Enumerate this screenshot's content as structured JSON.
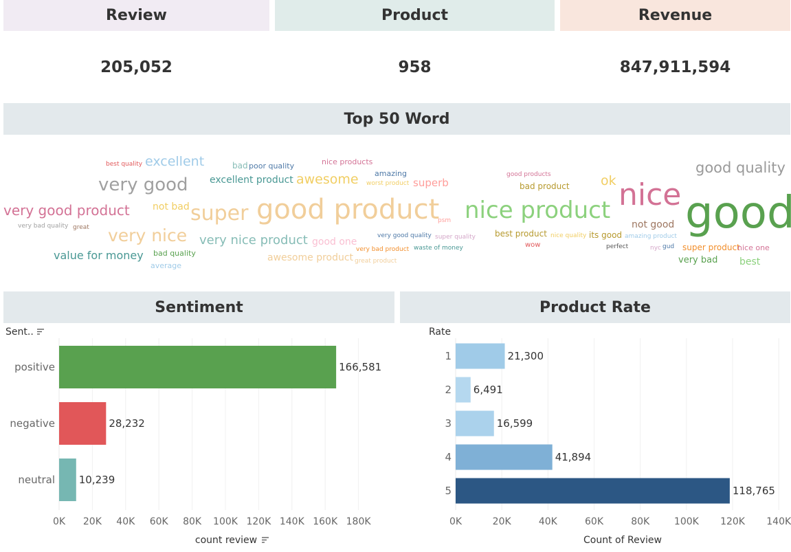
{
  "kpis": [
    {
      "label": "Review",
      "value": "205,052",
      "color": "#f1ebf3"
    },
    {
      "label": "Product",
      "value": "958",
      "color": "#e0ecea"
    },
    {
      "label": "Revenue",
      "value": "847,911,594",
      "color": "#f9e6dd"
    }
  ],
  "wordcloud": {
    "title": "Top 50 Word",
    "words": [
      {
        "text": "good",
        "color": "#59a14f"
      },
      {
        "text": "nice",
        "color": "#d37295"
      },
      {
        "text": "good product",
        "color": "#f1ce9a"
      },
      {
        "text": "nice product",
        "color": "#8cd17d"
      },
      {
        "text": "very good",
        "color": "#a0a0a0"
      },
      {
        "text": "super",
        "color": "#f1ce9a"
      },
      {
        "text": "very nice",
        "color": "#f1ce9a"
      },
      {
        "text": "very good product",
        "color": "#d37295"
      },
      {
        "text": "good quality",
        "color": "#9a9a9a"
      },
      {
        "text": "excellent",
        "color": "#a0cbe8"
      },
      {
        "text": "awesome",
        "color": "#f1ce63"
      },
      {
        "text": "very nice product",
        "color": "#86bcb6"
      },
      {
        "text": "value for money",
        "color": "#499894"
      },
      {
        "text": "excellent product",
        "color": "#499894"
      },
      {
        "text": "superb",
        "color": "#ff9d9a"
      },
      {
        "text": "ok",
        "color": "#f1ce63"
      },
      {
        "text": "awesome product",
        "color": "#f1ce9a"
      },
      {
        "text": "not good",
        "color": "#9d7660"
      },
      {
        "text": "good one",
        "color": "#fabfd2"
      },
      {
        "text": "not bad",
        "color": "#f1ce63"
      },
      {
        "text": "very bad",
        "color": "#59a14f"
      },
      {
        "text": "best",
        "color": "#8cd17d"
      },
      {
        "text": "best product",
        "color": "#b6992d"
      },
      {
        "text": "bad product",
        "color": "#b6992d"
      },
      {
        "text": "poor quality",
        "color": "#4e79a7"
      },
      {
        "text": "bad",
        "color": "#86bcb6"
      },
      {
        "text": "nice products",
        "color": "#d37295"
      },
      {
        "text": "amazing",
        "color": "#4e79a7"
      },
      {
        "text": "bad quality",
        "color": "#59a14f"
      },
      {
        "text": "average",
        "color": "#a0cbe8"
      },
      {
        "text": "super product",
        "color": "#f28e2b"
      },
      {
        "text": "nice one",
        "color": "#d37295"
      },
      {
        "text": "its good",
        "color": "#b6992d"
      },
      {
        "text": "wow",
        "color": "#e15759"
      },
      {
        "text": "best quality",
        "color": "#e15759"
      },
      {
        "text": "worst product",
        "color": "#f1ce63"
      },
      {
        "text": "good products",
        "color": "#d37295"
      },
      {
        "text": "very bad quality",
        "color": "#a0a0a0"
      },
      {
        "text": "great",
        "color": "#9d7660"
      },
      {
        "text": "psm",
        "color": "#ff9d9a"
      },
      {
        "text": "very good quality",
        "color": "#4e79a7"
      },
      {
        "text": "super quality",
        "color": "#d4a6c8"
      },
      {
        "text": "very bad product",
        "color": "#f28e2b"
      },
      {
        "text": "waste of money",
        "color": "#499894"
      },
      {
        "text": "great product",
        "color": "#f1ce9a"
      },
      {
        "text": "nice quality",
        "color": "#f1ce63"
      },
      {
        "text": "amazing product",
        "color": "#a0cbe8"
      },
      {
        "text": "perfect",
        "color": "#555555"
      },
      {
        "text": "nyc",
        "color": "#d4a6c8"
      },
      {
        "text": "gud",
        "color": "#4e79a7"
      }
    ]
  },
  "sentiment": {
    "title": "Sentiment",
    "axis_header": "Sent..",
    "xlabel": "count review",
    "chart_data": {
      "type": "bar",
      "orientation": "horizontal",
      "categories": [
        "positive",
        "negative",
        "neutral"
      ],
      "values": [
        166581,
        28232,
        10239
      ],
      "value_labels": [
        "166,581",
        "28,232",
        "10,239"
      ],
      "colors": [
        "#59a14f",
        "#e15759",
        "#76b7b2"
      ],
      "xlim": [
        0,
        200000
      ],
      "ticks": [
        0,
        20000,
        40000,
        60000,
        80000,
        100000,
        120000,
        140000,
        160000,
        180000
      ],
      "tick_labels": [
        "0K",
        "20K",
        "40K",
        "60K",
        "80K",
        "100K",
        "120K",
        "140K",
        "160K",
        "180K"
      ],
      "xlabel": "count review",
      "grid": true
    }
  },
  "product_rate": {
    "title": "Product Rate",
    "axis_header": "Rate",
    "xlabel": "Count of Review",
    "chart_data": {
      "type": "bar",
      "orientation": "horizontal",
      "categories": [
        "1",
        "2",
        "3",
        "4",
        "5"
      ],
      "values": [
        21300,
        6491,
        16599,
        41894,
        118765
      ],
      "value_labels": [
        "21,300",
        "6,491",
        "16,599",
        "41,894",
        "118,765"
      ],
      "colors": [
        "#a0cbe8",
        "#b5d8ef",
        "#abd2ec",
        "#7fb0d6",
        "#2c5784"
      ],
      "xlim": [
        0,
        145000
      ],
      "ticks": [
        0,
        20000,
        40000,
        60000,
        80000,
        100000,
        120000,
        140000
      ],
      "tick_labels": [
        "0K",
        "20K",
        "40K",
        "60K",
        "80K",
        "100K",
        "120K",
        "140K"
      ],
      "xlabel": "Count of Review",
      "grid": true
    }
  }
}
